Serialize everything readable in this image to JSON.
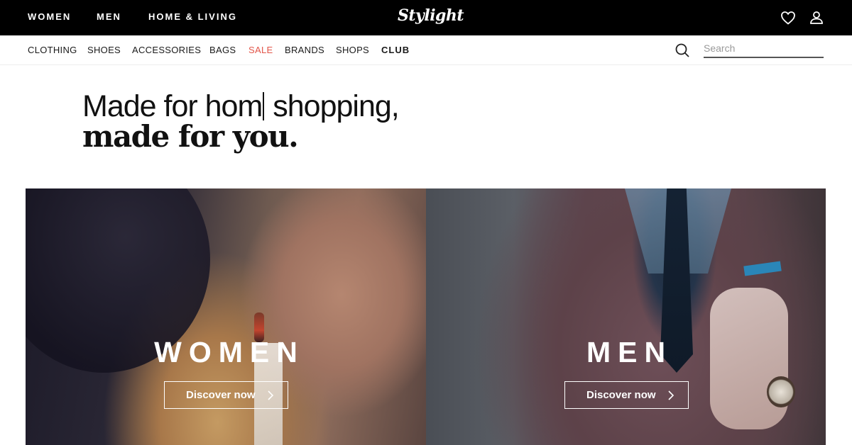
{
  "topnav": {
    "items": [
      "WOMEN",
      "MEN",
      "HOME & LIVING"
    ],
    "logo": "Stylight",
    "icons": [
      "heart-icon",
      "user-icon"
    ]
  },
  "subnav": {
    "items": [
      "CLOTHING",
      "SHOES",
      "ACCESSORIES",
      "BAGS",
      "SALE",
      "BRANDS",
      "SHOPS",
      "CLUB"
    ],
    "search_placeholder": "Search",
    "sale_color": "#e2564a"
  },
  "headline": {
    "line1_before": "Made for hom",
    "line1_after": " shopping,",
    "line2": "made for you."
  },
  "hero": {
    "women": {
      "title": "WOMEN",
      "cta": "Discover now"
    },
    "men": {
      "title": "MEN",
      "cta": "Discover now"
    }
  }
}
